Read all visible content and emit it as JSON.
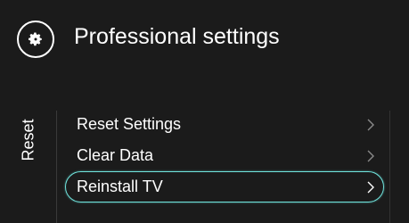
{
  "header": {
    "title": "Professional settings",
    "icon": "gear-icon"
  },
  "section": {
    "label": "Reset"
  },
  "menu": {
    "items": [
      {
        "label": "Reset Settings",
        "icon": "chevron-right-icon",
        "selected": false
      },
      {
        "label": "Clear Data",
        "icon": "chevron-right-icon",
        "selected": false
      },
      {
        "label": "Reinstall TV",
        "icon": "chevron-right-icon",
        "selected": true
      }
    ]
  },
  "colors": {
    "background": "#1b1b1b",
    "text": "#ffffff",
    "focus_outline": "#6fe3dc"
  }
}
